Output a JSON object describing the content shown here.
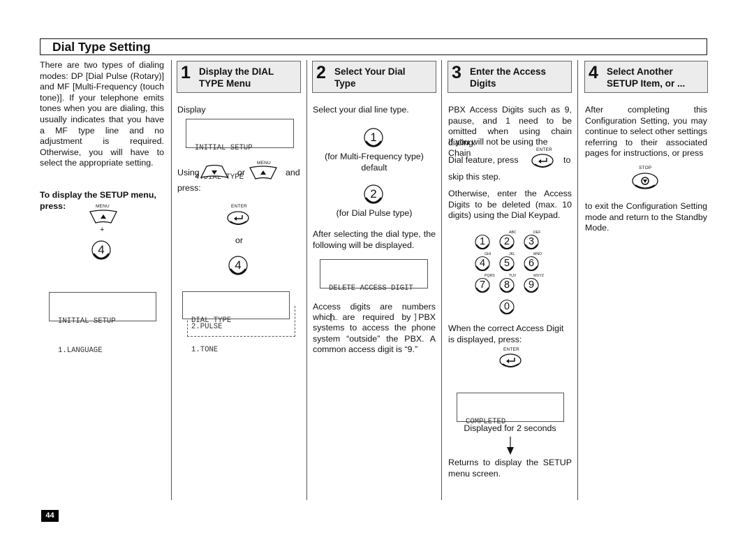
{
  "header": {
    "title": "Dial Type Setting"
  },
  "intro": {
    "paragraph": "There are two types of dialing modes: DP [Dial Pulse (Rotary)] and MF [Multi-Frequency (touch tone)]. If your telephone emits tones when you are dialing, this usually indicates that you have a MF type line and no adjustment is required. Otherwise, you will have to select the appropriate setting.",
    "instruction": "To display the SETUP menu, press:",
    "menu_key_label": "MENU",
    "plus": "+",
    "key_4": "4",
    "lcd": [
      "INITIAL SETUP",
      "1.LANGUAGE"
    ]
  },
  "steps": [
    {
      "number": "1",
      "title_line1": "Display the DIAL",
      "title_line2": "TYPE Menu",
      "display_label": "Display",
      "lcd": [
        "INITIAL SETUP",
        "4.DIAL TYPE"
      ],
      "using": "Using",
      "or": "or",
      "and": "and",
      "menu_key_label": "MENU",
      "press": "press:",
      "enter_key_label": "ENTER",
      "or2": "or",
      "key_4": "4",
      "lcd2": [
        "DIAL TYPE",
        "1.TONE"
      ],
      "lcd2_alt": "2.PULSE"
    },
    {
      "number": "2",
      "title_line1": "Select Your Dial",
      "title_line2": "Type",
      "intro": "Select your dial line type.",
      "key_1": "1",
      "key_1_caption1": "(for Multi-Frequency type)",
      "key_1_caption2": "default",
      "key_2": "2",
      "key_2_caption": "(for Dial Pulse type)",
      "after_text": "After selecting the dial type, the following will be displayed.",
      "lcd": [
        "DELETE ACCESS DIGIT",
        "[_                 ]"
      ],
      "access_text": "Access digits are numbers which are required by PBX systems to access the phone system “outside” the PBX. A common access digit is “9.”"
    },
    {
      "number": "3",
      "title_line1": "Enter the Access",
      "title_line2": "Digits",
      "para1": "PBX Access Digits such as 9, pause, and 1 need to be omitted when using chain dialing.",
      "para2": "If you will not be using the Chain",
      "dial_feature": "Dial feature, press",
      "to": "to",
      "skip": "skip this step.",
      "enter_key_label": "ENTER",
      "otherwise": "Otherwise, enter the Access Digits to be deleted (max. 10 digits) using the Dial Keypad.",
      "keypad": [
        {
          "digit": "1",
          "letters": ""
        },
        {
          "digit": "2",
          "letters": "ABC"
        },
        {
          "digit": "3",
          "letters": "DEF"
        },
        {
          "digit": "4",
          "letters": "GHI"
        },
        {
          "digit": "5",
          "letters": "JKL"
        },
        {
          "digit": "6",
          "letters": "MNO"
        },
        {
          "digit": "7",
          "letters": "PQRS"
        },
        {
          "digit": "8",
          "letters": "TUV"
        },
        {
          "digit": "9",
          "letters": "WXYZ"
        },
        {
          "digit": "0",
          "letters": ""
        }
      ],
      "when_correct": "When the correct Access Digit is displayed, press:",
      "lcd": [
        "COMPLETED"
      ],
      "displayed_for": "Displayed for 2 seconds",
      "returns": "Returns to display the SETUP menu screen."
    },
    {
      "number": "4",
      "title_line1": "Select Another",
      "title_line2": "SETUP Item, or ...",
      "para1": "After completing this Configuration Setting, you may continue to select other settings referring to their associated pages for instructions, or press",
      "stop_key_label": "STOP",
      "para2": "to exit the Configuration Setting mode and return to the Standby Mode."
    }
  ],
  "footer": {
    "page_number": "44"
  }
}
